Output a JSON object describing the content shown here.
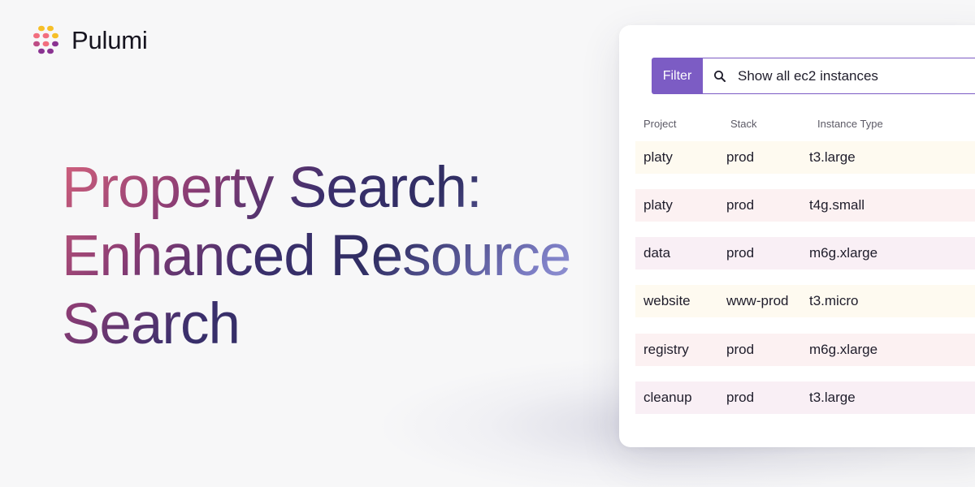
{
  "brand": {
    "name": "Pulumi"
  },
  "headline": {
    "line1": "Property Search:",
    "line2": "Enhanced Resource",
    "line3": "Search"
  },
  "filter": {
    "button_label": "Filter",
    "query": "Show all ec2 instances"
  },
  "table": {
    "columns": [
      "Project",
      "Stack",
      "Instance Type"
    ],
    "rows": [
      {
        "project": "platy",
        "stack": "prod",
        "instance_type": "t3.large",
        "color": "#fefaf0"
      },
      {
        "project": "platy",
        "stack": "prod",
        "instance_type": "t4g.small",
        "color": "#fcf1f2"
      },
      {
        "project": "data",
        "stack": "prod",
        "instance_type": "m6g.xlarge",
        "color": "#f9eff5"
      },
      {
        "project": "website",
        "stack": "www-prod",
        "instance_type": "t3.micro",
        "color": "#fefaf0"
      },
      {
        "project": "registry",
        "stack": "prod",
        "instance_type": "m6g.xlarge",
        "color": "#fcf1f2"
      },
      {
        "project": "cleanup",
        "stack": "prod",
        "instance_type": "t3.large",
        "color": "#f9eff5"
      }
    ]
  },
  "colors": {
    "accent": "#7c5cc4"
  }
}
